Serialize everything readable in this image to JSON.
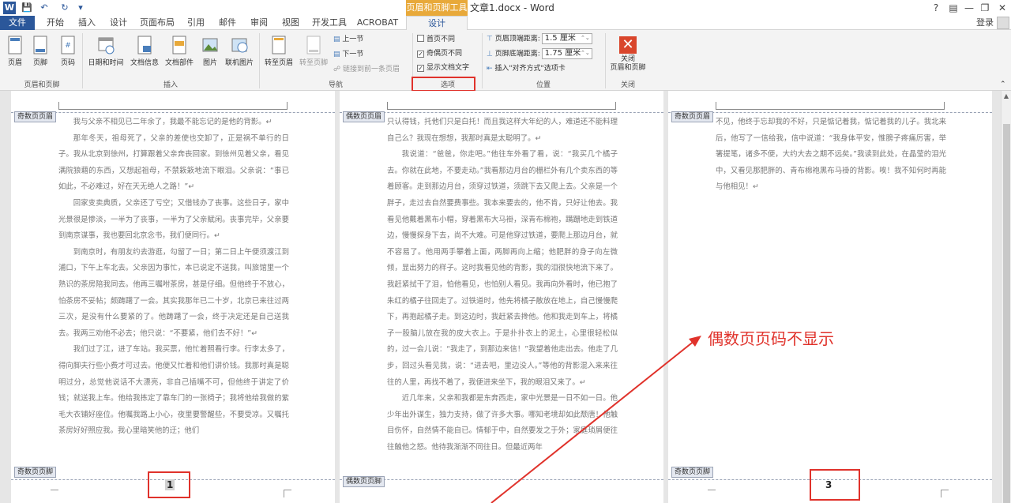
{
  "app": {
    "context_group": "页眉和页脚工具",
    "document_title": "文章1.docx - Word",
    "help": "?",
    "login": "登录"
  },
  "tabs": [
    "文件",
    "开始",
    "插入",
    "设计",
    "页面布局",
    "引用",
    "邮件",
    "审阅",
    "视图",
    "开发工具",
    "ACROBAT",
    "设计"
  ],
  "ribbon": {
    "hf_group": {
      "label": "页眉和页脚",
      "header": "页眉",
      "footer": "页脚",
      "page_number": "页码"
    },
    "insert_group": {
      "label": "插入",
      "datetime": "日期和时间",
      "docinfo": "文档信息",
      "docparts": "文档部件",
      "picture": "图片",
      "online_picture": "联机图片"
    },
    "nav_group": {
      "label": "导航",
      "goto_header": "转至页眉",
      "goto_footer": "转至页脚",
      "prev": "上一节",
      "next": "下一节",
      "link_prev": "链接到前一条页眉"
    },
    "options_group": {
      "label": "选项",
      "diff_first": "首页不同",
      "diff_odd_even": "奇偶页不同",
      "show_doc_text": "显示文档文字",
      "diff_first_checked": false,
      "diff_odd_even_checked": true,
      "show_doc_text_checked": true
    },
    "position_group": {
      "label": "位置",
      "header_top_label": "页眉顶端距离:",
      "header_top_value": "1.5 厘米",
      "footer_bottom_label": "页脚底端距离:",
      "footer_bottom_value": "1.75 厘米",
      "insert_align_tab": "插入\"对齐方式\"选项卡"
    },
    "close_group": {
      "label": "关闭",
      "close_line1": "关闭",
      "close_line2": "页眉和页脚"
    }
  },
  "pages": [
    {
      "header_tag": "奇数页页眉",
      "footer_tag": "奇数页页脚",
      "page_number": "1",
      "paragraphs": [
        "我与父亲不相见已二年余了，我最不能忘记的是他的背影。↵",
        "那年冬天，祖母死了，父亲的差使也交卸了，正是祸不单行的日子。我从北京到徐州，打算跟着父亲奔丧回家。到徐州见着父亲，看见满院狼藉的东西，又想起祖母，不禁簌簌地流下眼泪。父亲说：“事已如此，不必难过，好在天无绝人之路！”↵",
        "回家变卖典质，父亲还了亏空；又借钱办了丧事。这些日子，家中光景很是惨淡，一半为了丧事，一半为了父亲赋闲。丧事完毕，父亲要到南京谋事，我也要回北京念书，我们便同行。↵",
        "到南京时，有朋友约去游逛，勾留了一日；第二日上午便须渡江到浦口，下午上车北去。父亲因为事忙，本已说定不送我，叫旅馆里一个熟识的茶房陪我同去。他再三嘱咐茶房，甚是仔细。但他终于不放心，怕茶房不妥帖；颇踌躇了一会。其实我那年已二十岁，北京已来往过两三次，是没有什么要紧的了。他踌躇了一会，终于决定还是自己送我去。我两三劝他不必去；他只说：“不要紧，他们去不好！”↵",
        "我们过了江，进了车站。我买票，他忙着照看行李。行李太多了，得向脚夫行些小费才可过去。他便又忙着和他们讲价钱。我那时真是聪明过分，总觉他说话不大漂亮，非自己插嘴不可，但他终于讲定了价钱；就送我上车。他给我拣定了靠车门的一张椅子；我将他给我做的紫毛大衣铺好座位。他嘱我路上小心，夜里要警醒些，不要受凉。又嘱托茶房好好照应我。我心里暗笑他的迂；他们"
      ]
    },
    {
      "header_tag": "偶数页页眉",
      "footer_tag": "偶数页页脚",
      "page_number": "",
      "paragraphs": [
        "只认得钱，托他们只是白托！而且我这样大年纪的人，难道还不能料理自己么？我现在想想，我那时真是太聪明了。↵",
        "我说道：“爸爸，你走吧。”他往车外看了看，说：“我买几个橘子去。你就在此地，不要走动。”我看那边月台的栅栏外有几个卖东西的等着顾客。走到那边月台，须穿过铁道，须跳下去又爬上去。父亲是一个胖子，走过去自然要费事些。我本来要去的，他不肯，只好让他去。我看见他戴着黑布小帽，穿着黑布大马褂，深青布棉袍，蹒跚地走到铁道边，慢慢探身下去，尚不大难。可是他穿过铁道，要爬上那边月台，就不容易了。他用两手攀着上面，两脚再向上缩；他肥胖的身子向左微倾，显出努力的样子。这时我看见他的背影，我的泪很快地流下来了。我赶紧拭干了泪，怕他看见，也怕别人看见。我再向外看时，他已抱了朱红的橘子往回走了。过铁道时，他先将橘子散放在地上，自己慢慢爬下，再抱起橘子走。到这边时，我赶紧去搀他。他和我走到车上，将橘子一股脑儿放在我的皮大衣上。于是扑扑衣上的泥土，心里很轻松似的，过一会儿说：“我走了，到那边来信！”我望着他走出去。他走了几步，回过头看见我，说：“进去吧，里边没人。”等他的背影混入来来往往的人里，再找不着了，我便进来坐下，我的眼泪又来了。↵",
        "近几年来，父亲和我都是东奔西走，家中光景是一日不如一日。他少年出外谋生，独力支持，做了许多大事。哪知老境却如此颓唐！他触目伤怀，自然情不能自已。情郁于中，自然要发之于外；家庭琐屑便往往触他之怒。他待我渐渐不同往日。但最近两年"
      ]
    },
    {
      "header_tag": "奇数页页眉",
      "footer_tag": "奇数页页脚",
      "page_number": "3",
      "paragraphs": [
        "不见，他终于忘却我的不好，只是惦记着我，惦记着我的儿子。我北来后，他写了一信给我，信中说道：“我身体平安，惟膀子疼痛厉害，举箸提笔，诸多不便，大约大去之期不远矣。”我读到此处，在晶莹的泪光中，又看见那肥胖的、青布棉袍黑布马褂的背影。唉！我不知何时再能与他相见！↵"
      ]
    }
  ],
  "annotation": "偶数页页码不显示",
  "colors": {
    "accent": "#2b579a",
    "context_tab": "#e8a93a",
    "highlight": "#e0322b"
  }
}
